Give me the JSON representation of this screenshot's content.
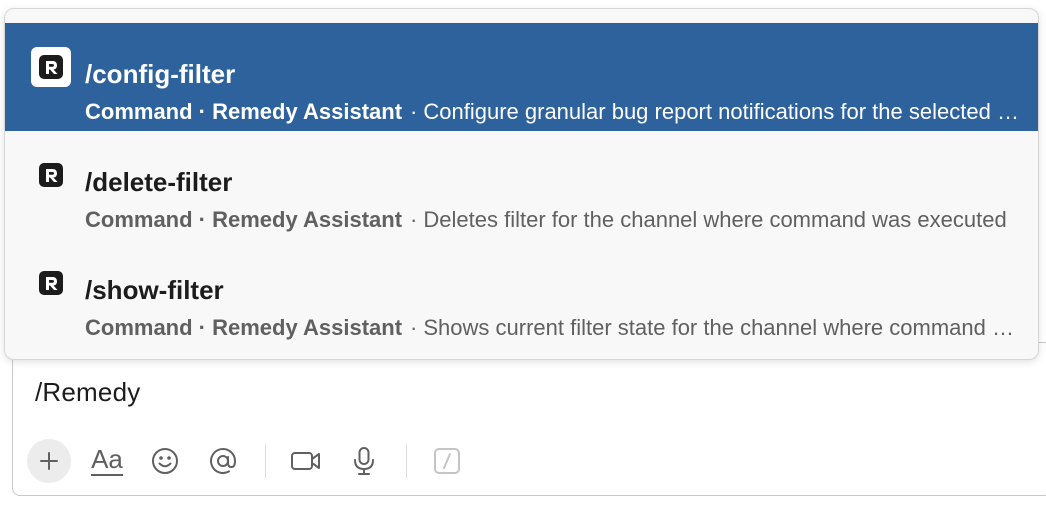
{
  "popup": {
    "items": [
      {
        "command": "/config-filter",
        "meta": "Command · Remedy Assistant",
        "separator": "·",
        "description": "Configure granular bug report notifications for the selected channel",
        "icon": "remedy-logo-icon",
        "selected": true
      },
      {
        "command": "/delete-filter",
        "meta": "Command · Remedy Assistant",
        "separator": "·",
        "description": "Deletes filter for the channel where command was executed",
        "icon": "remedy-logo-icon",
        "selected": false
      },
      {
        "command": "/show-filter",
        "meta": "Command · Remedy Assistant",
        "separator": "·",
        "description": "Shows current filter state for the channel where command was executed",
        "icon": "remedy-logo-icon",
        "selected": false
      }
    ]
  },
  "composer": {
    "text": "/Remedy",
    "toolbar": {
      "plus_icon": "plus-icon",
      "format_label": "Aa",
      "emoji_icon": "emoji-icon",
      "mention_icon": "at-mention-icon",
      "video_icon": "video-camera-icon",
      "audio_icon": "microphone-icon",
      "slash_icon": "slash-command-icon"
    }
  },
  "colors": {
    "selected_bg": "#2e629d",
    "popup_bg": "#f8f8f8",
    "muted_text": "#616061",
    "text": "#1d1c1d"
  }
}
